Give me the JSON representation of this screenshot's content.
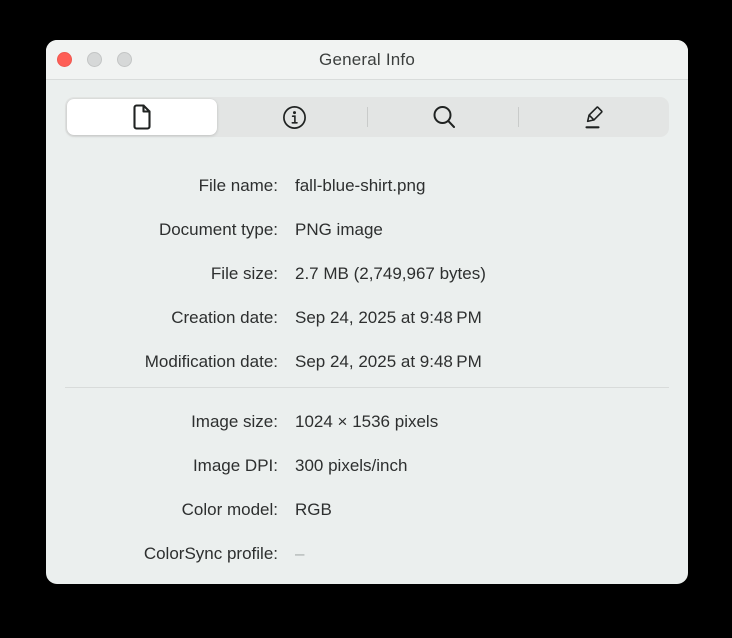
{
  "window": {
    "title": "General Info"
  },
  "traffic_lights": {
    "close_color": "#fe5e56",
    "minimize_color": "#d6d8d8",
    "zoom_color": "#d6d8d8"
  },
  "tabs": [
    {
      "name": "general-info-tab",
      "icon": "document-icon",
      "selected": true
    },
    {
      "name": "more-info-tab",
      "icon": "info-icon",
      "selected": false
    },
    {
      "name": "keywords-tab",
      "icon": "search-icon",
      "selected": false
    },
    {
      "name": "annotations-tab",
      "icon": "pencil-icon",
      "selected": false
    }
  ],
  "general": {
    "rows": [
      {
        "label": "File name:",
        "value": "fall-blue-shirt.png"
      },
      {
        "label": "Document type:",
        "value": "PNG image"
      },
      {
        "label": "File size:",
        "value": "2.7 MB (2,749,967 bytes)"
      },
      {
        "label": "Creation date:",
        "value": "Sep 24, 2025 at 9:48 PM"
      },
      {
        "label": "Modification date:",
        "value": "Sep 24, 2025 at 9:48 PM"
      }
    ]
  },
  "image": {
    "rows": [
      {
        "label": "Image size:",
        "value": "1024 × 1536 pixels"
      },
      {
        "label": "Image DPI:",
        "value": "300 pixels/inch"
      },
      {
        "label": "Color model:",
        "value": "RGB"
      },
      {
        "label": "ColorSync profile:",
        "value": "–"
      }
    ]
  },
  "colors": {
    "window_background": "#ebefee",
    "titlebar_background": "#f1f3f2",
    "segmented_track": "#e3e5e4",
    "selected_segment": "#ffffff",
    "text": "#2d2f2f",
    "muted_text": "#a9aead",
    "divider": "#d8dbda"
  }
}
